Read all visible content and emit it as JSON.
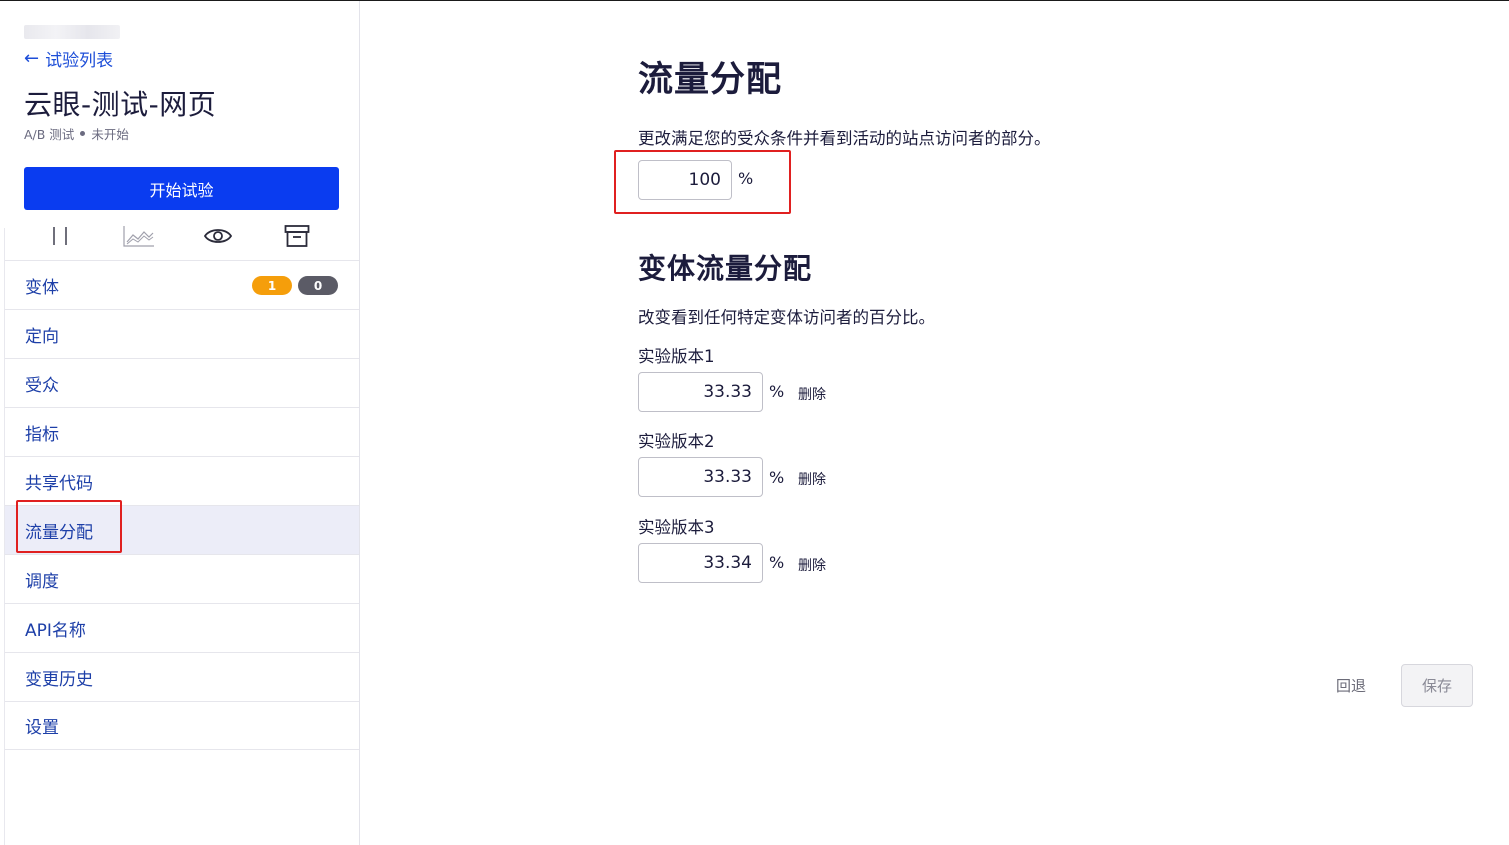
{
  "sidebar": {
    "back_label": "试验列表",
    "experiment_title": "云眼-测试-网页",
    "experiment_type": "A/B 测试",
    "experiment_status": "未开始",
    "start_button": "开始试验",
    "toolbar_icons": [
      "pause-icon",
      "chart-icon",
      "eye-icon",
      "archive-icon"
    ],
    "nav": [
      {
        "label": "变体",
        "badges": [
          "1",
          "0"
        ]
      },
      {
        "label": "定向"
      },
      {
        "label": "受众"
      },
      {
        "label": "指标"
      },
      {
        "label": "共享代码"
      },
      {
        "label": "流量分配",
        "active": true
      },
      {
        "label": "调度"
      },
      {
        "label": "API名称"
      },
      {
        "label": "变更历史"
      },
      {
        "label": "设置"
      }
    ]
  },
  "main": {
    "title": "流量分配",
    "description": "更改满足您的受众条件并看到活动的站点访问者的部分。",
    "traffic_value": "100",
    "percent_sign": "%",
    "variation_title": "变体流量分配",
    "variation_description": "改变看到任何特定变体访问者的百分比。",
    "variations": [
      {
        "label": "实验版本1",
        "value": "33.33",
        "delete": "删除"
      },
      {
        "label": "实验版本2",
        "value": "33.33",
        "delete": "删除"
      },
      {
        "label": "实验版本3",
        "value": "33.34",
        "delete": "删除"
      }
    ],
    "revert_button": "回退",
    "save_button": "保存"
  },
  "colors": {
    "primary_button": "#0a3cf0",
    "link": "#1d4ed8",
    "badge_orange": "#f59e0b",
    "badge_gray": "#5b5b66",
    "highlight_box": "#e02020"
  }
}
